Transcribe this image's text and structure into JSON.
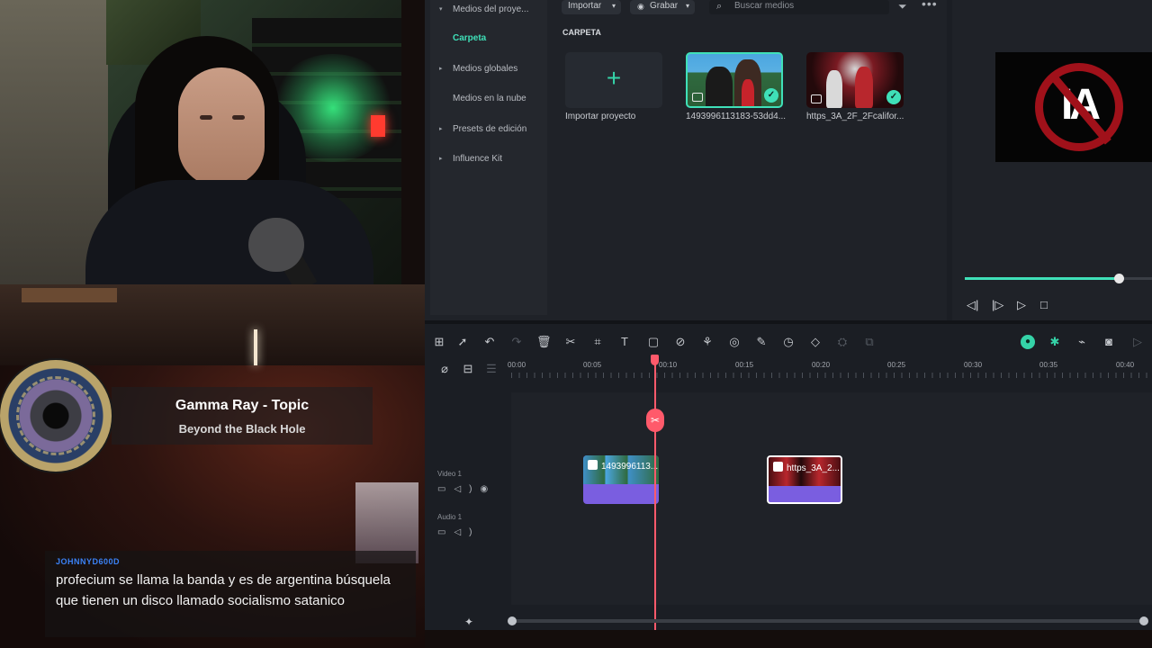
{
  "stream": {
    "now_playing": {
      "artist": "Gamma Ray - Topic",
      "track": "Beyond the Black Hole"
    },
    "chat": {
      "username": "JOHNNYD600D",
      "message": "profecium se llama la banda y es de argentina búsquela que tienen un disco llamado socialismo satanico"
    }
  },
  "editor": {
    "sidebar": {
      "items": [
        {
          "label": "Medios del proye...",
          "chevron": "▾"
        },
        {
          "label": "Carpeta",
          "chevron": ""
        },
        {
          "label": "Medios globales",
          "chevron": "▸"
        },
        {
          "label": "Medios en la nube",
          "chevron": ""
        },
        {
          "label": "Presets de edición",
          "chevron": "▸"
        },
        {
          "label": "Influence Kit",
          "chevron": "▸"
        }
      ]
    },
    "media_toolbar": {
      "import_label": "Importar",
      "record_label": "Grabar",
      "search_placeholder": "Buscar medios"
    },
    "folder_label": "CARPETA",
    "media_items": [
      {
        "label": "Importar proyecto"
      },
      {
        "label": "1493996113183-53dd4..."
      },
      {
        "label": "https_3A_2F_2Fcalifor..."
      }
    ],
    "preview": {
      "logo_text": "IA",
      "progress": 0.82
    },
    "timeline": {
      "ruler_labels": [
        "00:00",
        "00:05",
        "00:10",
        "00:15",
        "00:20",
        "00:25",
        "00:30",
        "00:35",
        "00:40"
      ],
      "tracks": [
        {
          "label": "Video 1"
        },
        {
          "label": "Audio 1"
        }
      ],
      "clips": [
        {
          "name": "1493996113..."
        },
        {
          "name": "https_3A_2..."
        }
      ],
      "scroll_position": 0.0
    },
    "colors": {
      "accent": "#3fe0b8",
      "playhead": "#ff5a6b",
      "clip": "#7a5ee0",
      "panel": "#1f2228"
    }
  }
}
